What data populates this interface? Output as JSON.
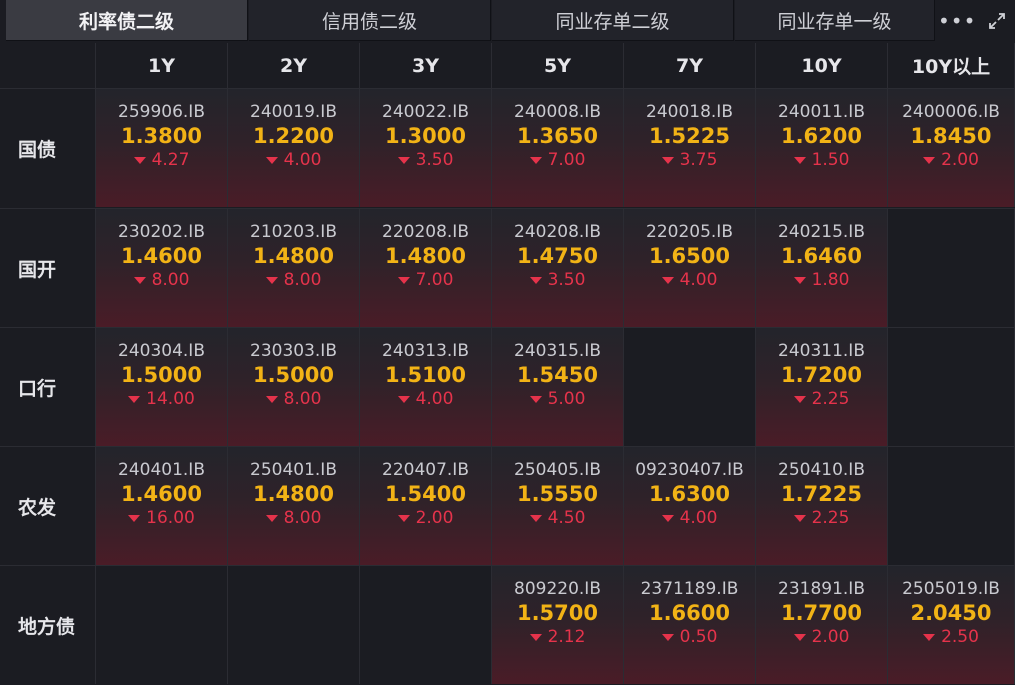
{
  "tabs": [
    {
      "label": "利率债二级",
      "active": true
    },
    {
      "label": "信用债二级",
      "active": false
    },
    {
      "label": "同业存单二级",
      "active": false
    },
    {
      "label": "同业存单一级",
      "active": false
    }
  ],
  "actions": {
    "more": "more-icon",
    "expand": "expand-icon"
  },
  "columns": [
    "1Y",
    "2Y",
    "3Y",
    "5Y",
    "7Y",
    "10Y",
    "10Y以上"
  ],
  "colors": {
    "rate": "#f2b316",
    "change_down": "#e5334b",
    "background": "#1b1c22"
  },
  "rows": [
    {
      "label": "国债",
      "cells": [
        {
          "code": "259906.IB",
          "rate": "1.3800",
          "change": "4.27",
          "dir": "down"
        },
        {
          "code": "240019.IB",
          "rate": "1.2200",
          "change": "4.00",
          "dir": "down"
        },
        {
          "code": "240022.IB",
          "rate": "1.3000",
          "change": "3.50",
          "dir": "down"
        },
        {
          "code": "240008.IB",
          "rate": "1.3650",
          "change": "7.00",
          "dir": "down"
        },
        {
          "code": "240018.IB",
          "rate": "1.5225",
          "change": "3.75",
          "dir": "down"
        },
        {
          "code": "240011.IB",
          "rate": "1.6200",
          "change": "1.50",
          "dir": "down"
        },
        {
          "code": "2400006.IB",
          "rate": "1.8450",
          "change": "2.00",
          "dir": "down"
        }
      ]
    },
    {
      "label": "国开",
      "cells": [
        {
          "code": "230202.IB",
          "rate": "1.4600",
          "change": "8.00",
          "dir": "down"
        },
        {
          "code": "210203.IB",
          "rate": "1.4800",
          "change": "8.00",
          "dir": "down"
        },
        {
          "code": "220208.IB",
          "rate": "1.4800",
          "change": "7.00",
          "dir": "down"
        },
        {
          "code": "240208.IB",
          "rate": "1.4750",
          "change": "3.50",
          "dir": "down"
        },
        {
          "code": "220205.IB",
          "rate": "1.6500",
          "change": "4.00",
          "dir": "down"
        },
        {
          "code": "240215.IB",
          "rate": "1.6460",
          "change": "1.80",
          "dir": "down"
        },
        null
      ]
    },
    {
      "label": "口行",
      "cells": [
        {
          "code": "240304.IB",
          "rate": "1.5000",
          "change": "14.00",
          "dir": "down"
        },
        {
          "code": "230303.IB",
          "rate": "1.5000",
          "change": "8.00",
          "dir": "down"
        },
        {
          "code": "240313.IB",
          "rate": "1.5100",
          "change": "4.00",
          "dir": "down"
        },
        {
          "code": "240315.IB",
          "rate": "1.5450",
          "change": "5.00",
          "dir": "down"
        },
        null,
        {
          "code": "240311.IB",
          "rate": "1.7200",
          "change": "2.25",
          "dir": "down"
        },
        null
      ]
    },
    {
      "label": "农发",
      "cells": [
        {
          "code": "240401.IB",
          "rate": "1.4600",
          "change": "16.00",
          "dir": "down"
        },
        {
          "code": "250401.IB",
          "rate": "1.4800",
          "change": "8.00",
          "dir": "down"
        },
        {
          "code": "220407.IB",
          "rate": "1.5400",
          "change": "2.00",
          "dir": "down"
        },
        {
          "code": "250405.IB",
          "rate": "1.5550",
          "change": "4.50",
          "dir": "down"
        },
        {
          "code": "09230407.IB",
          "rate": "1.6300",
          "change": "4.00",
          "dir": "down"
        },
        {
          "code": "250410.IB",
          "rate": "1.7225",
          "change": "2.25",
          "dir": "down"
        },
        null
      ]
    },
    {
      "label": "地方债",
      "cells": [
        null,
        null,
        null,
        {
          "code": "809220.IB",
          "rate": "1.5700",
          "change": "2.12",
          "dir": "down"
        },
        {
          "code": "2371189.IB",
          "rate": "1.6600",
          "change": "0.50",
          "dir": "down"
        },
        {
          "code": "231891.IB",
          "rate": "1.7700",
          "change": "2.00",
          "dir": "down"
        },
        {
          "code": "2505019.IB",
          "rate": "2.0450",
          "change": "2.50",
          "dir": "down"
        }
      ]
    }
  ]
}
